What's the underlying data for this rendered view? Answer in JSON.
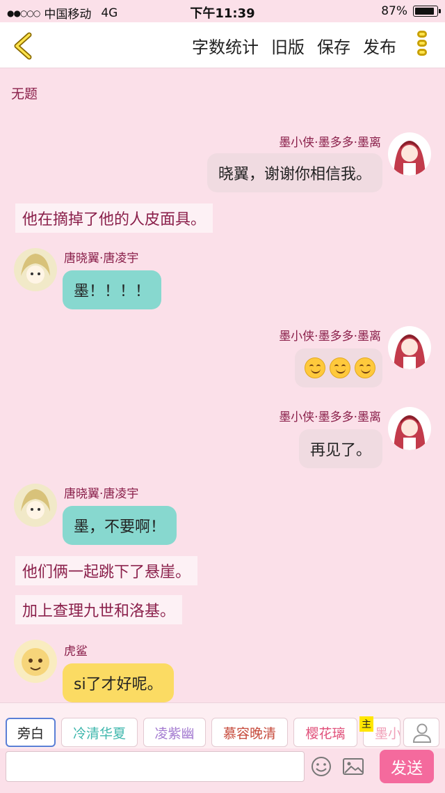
{
  "status": {
    "carrier": "中国移动",
    "network": "4G",
    "time": "下午11:39",
    "battery": "87%",
    "battery_level": 0.87
  },
  "nav": {
    "actions": [
      "字数统计",
      "旧版",
      "保存",
      "发布"
    ]
  },
  "chat": {
    "title": "无题",
    "messages": [
      {
        "type": "right",
        "name": "墨小侠·墨多多·墨离",
        "text": "晓翼，谢谢你相信我。"
      },
      {
        "type": "narration",
        "text": "他在摘掉了他的人皮面具。"
      },
      {
        "type": "left",
        "name": "唐晓翼·唐凌宇",
        "text": "墨！！！！"
      },
      {
        "type": "right",
        "name": "墨小侠·墨多多·墨离",
        "emoji": [
          "smiling-face",
          "smiling-face",
          "smiling-face"
        ]
      },
      {
        "type": "right",
        "name": "墨小侠·墨多多·墨离",
        "text": "再见了。"
      },
      {
        "type": "left",
        "name": "唐晓翼·唐凌宇",
        "text": "墨，不要啊！"
      },
      {
        "type": "narration",
        "text": "他们俩一起跳下了悬崖。"
      },
      {
        "type": "narration",
        "text": "加上查理九世和洛基。"
      },
      {
        "type": "left",
        "name": "虎鲨",
        "text": "si了才好呢。"
      }
    ]
  },
  "characters": {
    "tabs": [
      {
        "label": "旁白",
        "color": "#222222"
      },
      {
        "label": "冷清华夏",
        "color": "#3fb7ad"
      },
      {
        "label": "凌紫幽",
        "color": "#a37ad0"
      },
      {
        "label": "慕容晚清",
        "color": "#c64a3b"
      },
      {
        "label": "樱花璃",
        "color": "#e0507a"
      },
      {
        "label": "墨小侠",
        "color": "#f0a0b8"
      }
    ],
    "host_badge": "主"
  },
  "input": {
    "placeholder": "",
    "send_label": "发送"
  }
}
